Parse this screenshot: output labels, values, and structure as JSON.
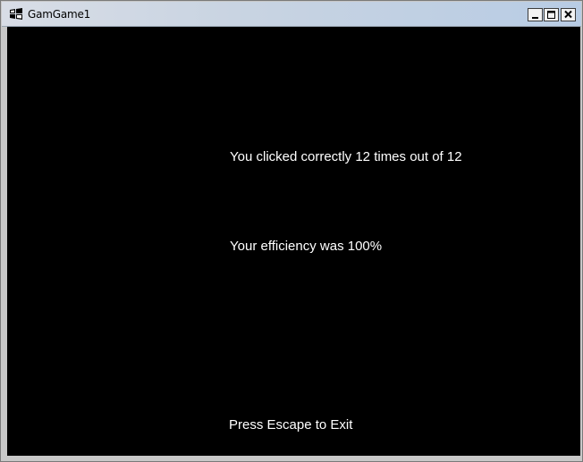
{
  "window": {
    "title": "GamGame1",
    "app_icon": "windows-flag-icon",
    "controls": {
      "minimize_icon": "minimize-icon",
      "maximize_icon": "maximize-icon",
      "close_icon": "close-icon"
    }
  },
  "game": {
    "background_color": "#000000",
    "text_color": "#ffffff",
    "result_line": "You clicked correctly 12 times out of 12",
    "efficiency_line": "Your efficiency was 100%",
    "exit_hint": "Press Escape to Exit"
  }
}
